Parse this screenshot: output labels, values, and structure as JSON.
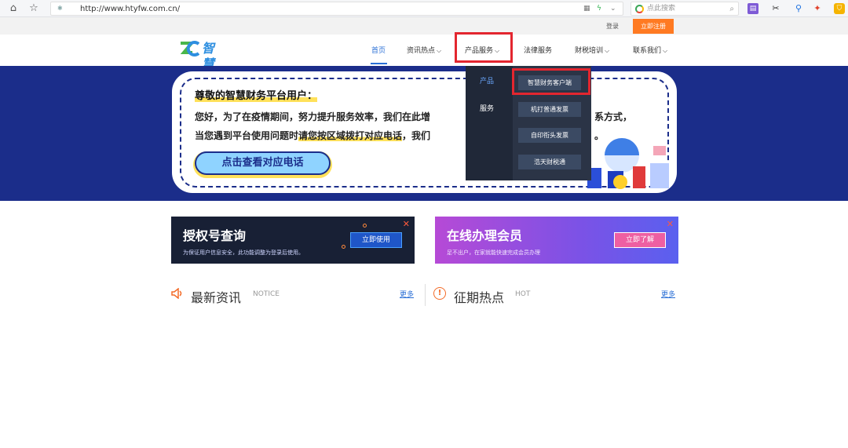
{
  "browser": {
    "url": "http://www.htyfw.com.cn/",
    "search_placeholder": "点此搜索"
  },
  "topbar": {
    "login_label": "登录",
    "register_label": "立即注册"
  },
  "header": {
    "logo_text": "智慧财务",
    "nav": [
      {
        "label": "首页"
      },
      {
        "label": "资讯热点"
      },
      {
        "label": "产品服务"
      },
      {
        "label": "法律服务"
      },
      {
        "label": "财税培训"
      },
      {
        "label": "联系我们"
      }
    ]
  },
  "dropdown": {
    "categories": [
      "产品",
      "服务"
    ],
    "items": [
      "智慧财务客户端",
      "机打普通发票",
      "自印衔头发票",
      "浩天财税通"
    ]
  },
  "banner": {
    "title": "尊敬的智慧财务平台用户：",
    "line1": "您好，为了在疫情期间，努力提升服务效率，我们在此增",
    "line1_tail": "系方式，",
    "line2_pre": "当您遇到平台使用问题时",
    "line2_hl": "请您按区域拨打对应电话",
    "line2_post": "，我们",
    "line2_tail": "。",
    "cta_label": "点击查看对应电话"
  },
  "promos": [
    {
      "title": "授权号查询",
      "subtitle": "为保证用户信息安全，此功能调整为登录后使用。",
      "button": "立即使用"
    },
    {
      "title": "在线办理会员",
      "subtitle": "足不出户，在家就能快速完成会员办理",
      "button": "立即了解"
    }
  ],
  "news": {
    "left": {
      "title": "最新资讯",
      "tag": "NOTICE",
      "more": "更多"
    },
    "right": {
      "title": "征期热点",
      "tag": "HOT",
      "more": "更多"
    }
  },
  "colors": {
    "brand_blue": "#2a6fd6",
    "banner_navy": "#1b2d8a",
    "highlight_red": "#e3262f",
    "register_orange": "#ff7a22"
  }
}
